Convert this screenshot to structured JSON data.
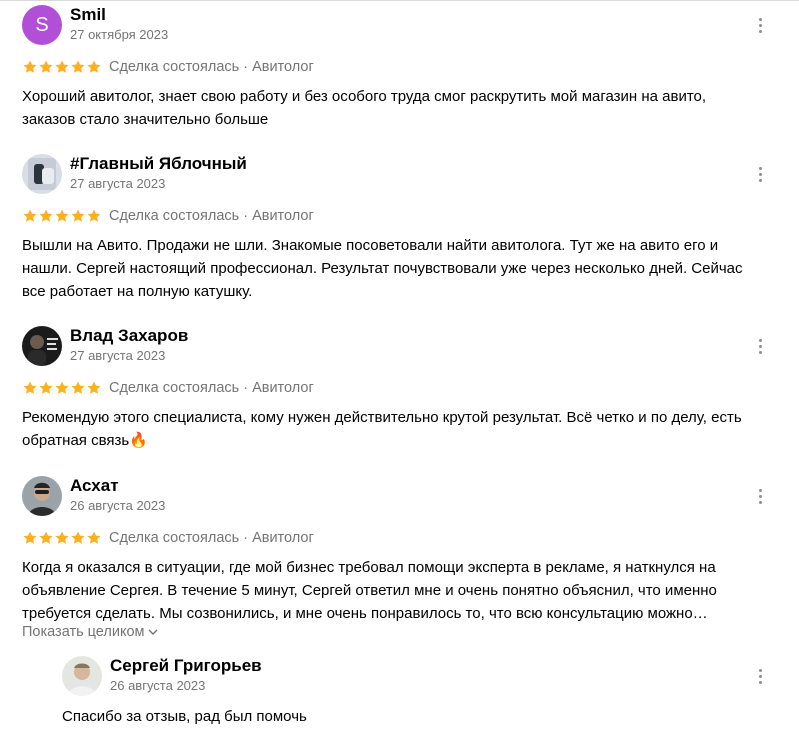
{
  "reviews": [
    {
      "author": "Smil",
      "avatar_letter": "S",
      "date": "27 октября 2023",
      "rating": 5,
      "deal": "Сделка состоялась · Авитолог",
      "text": "Хороший авитолог, знает свою работу и без особого труда смог раскрутить мой магазин на авито, заказов стало значительно больше"
    },
    {
      "author": "#Главный Яблочный",
      "date": "27 августа 2023",
      "rating": 5,
      "deal": "Сделка состоялась · Авитолог",
      "text": "Вышли на Авито. Продажи не шли. Знакомые посоветовали найти авитолога. Тут же на авито его и нашли. Сергей настоящий профессионал. Результат почувствовали уже через несколько дней. Сейчас все работает на полную катушку."
    },
    {
      "author": "Влад Захаров",
      "date": "27 августа 2023",
      "rating": 5,
      "deal": "Сделка состоялась · Авитолог",
      "text": "Рекомендую этого специалиста, кому нужен действительно крутой результат. Всё четко и по делу, есть обратная связь🔥"
    },
    {
      "author": "Асхат",
      "date": "26 августа 2023",
      "rating": 5,
      "deal": "Сделка состоялась · Авитолог",
      "text": "Когда я оказался в ситуации, где мой бизнес требовал помощи эксперта в рекламе, я наткнулся на объявление Сергея. В течение 5 минут, Сергей ответил мне и очень понятно объяснил, что именно требуется сделать. Мы созвонились, и мне очень понравилось то, что всю консультацию можно…",
      "show_more": "Показать целиком"
    }
  ],
  "reply": {
    "author": "Сергей Григорьев",
    "date": "26 августа 2023",
    "text": "Спасибо за отзыв, рад был помочь"
  },
  "colors": {
    "star": "#ffb021",
    "avatar_letter_bg": "#b14fd6",
    "muted_text": "#757575"
  }
}
